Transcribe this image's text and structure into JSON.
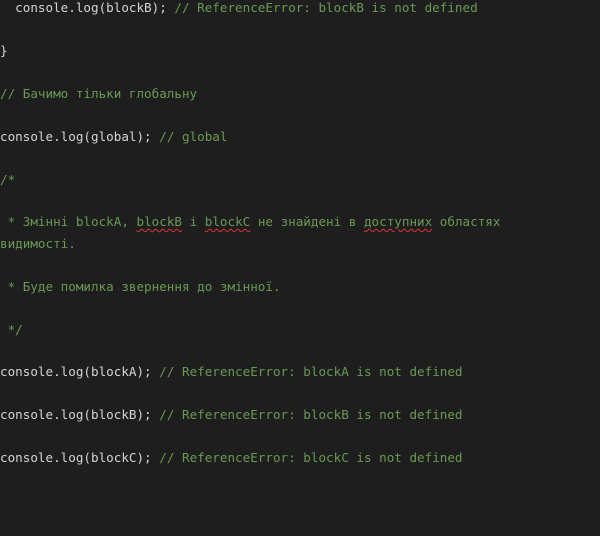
{
  "colors": {
    "background": "#1e1e1e",
    "code_text": "#d4d4d4",
    "comment_text": "#6a9955",
    "spell_squiggle": "#e03434"
  },
  "lines": {
    "l1": {
      "code": "  console.log(blockB); ",
      "comment": "// ReferenceError: blockB is not defined"
    },
    "l2": {
      "code": "}"
    },
    "l3": {
      "comment": "// Бачимо тільки глобальну"
    },
    "l4": {
      "code": "console.log(global); ",
      "comment": "// global"
    },
    "l5": {
      "comment": "/*"
    },
    "l6": {
      "c1": " * Змінні blockA, ",
      "w1": "blockB",
      "c2": " і ",
      "w2": "blockC",
      "c3": " не знайдені в ",
      "w3": "доступних",
      "c4": " областях"
    },
    "l7": {
      "comment": "видимості."
    },
    "l8": {
      "comment": " * Буде помилка звернення до змінної."
    },
    "l9": {
      "comment": " */"
    },
    "l10": {
      "code": "console.log(blockA); ",
      "comment": "// ReferenceError: blockA is not defined"
    },
    "l11": {
      "code": "console.log(blockB); ",
      "comment": "// ReferenceError: blockB is not defined"
    },
    "l12": {
      "code": "console.log(blockC); ",
      "comment": "// ReferenceError: blockC is not defined"
    }
  }
}
